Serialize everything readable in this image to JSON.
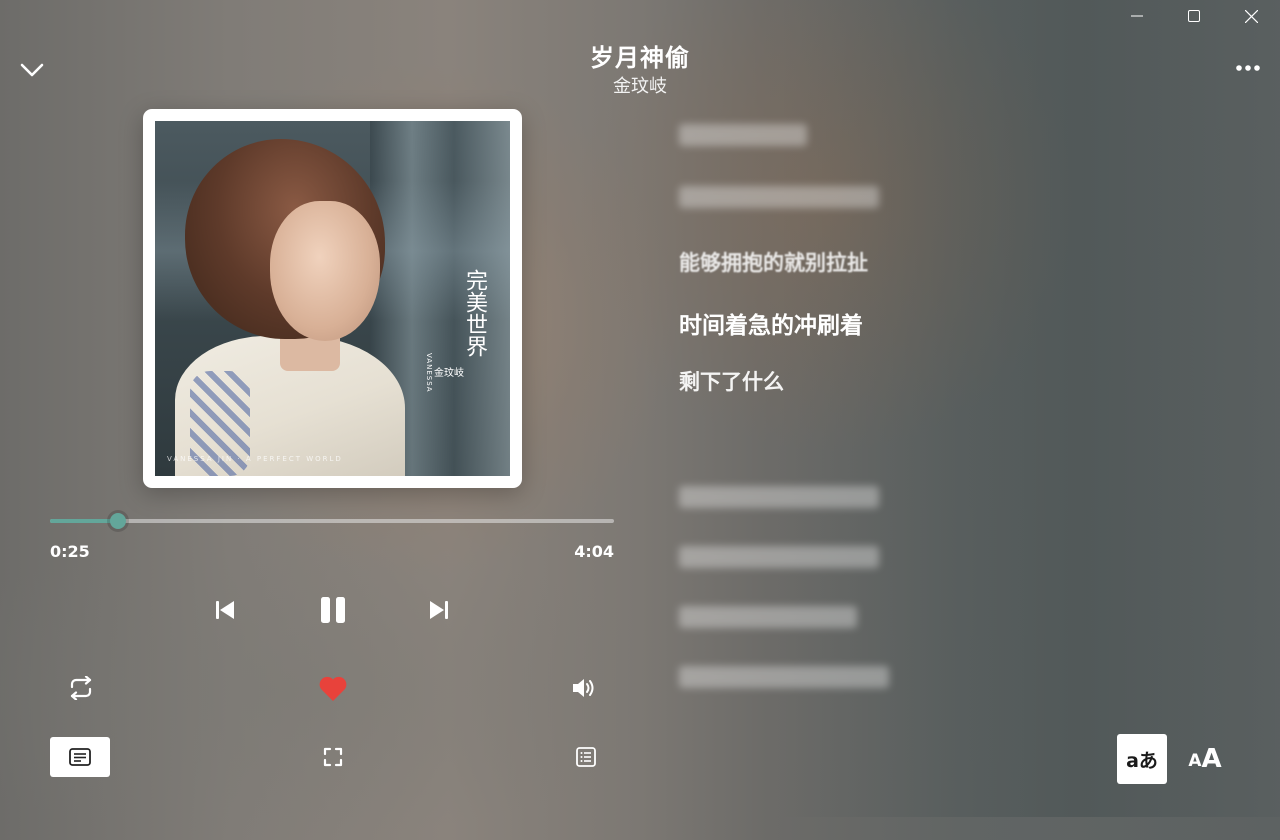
{
  "window": {
    "minimize_icon": "minimize-icon",
    "maximize_icon": "maximize-icon",
    "close_icon": "close-icon"
  },
  "header": {
    "collapse_icon": "chevron-down-icon",
    "title": "岁月神偷",
    "artist": "金玟岐",
    "more_icon": "more-horizontal-icon"
  },
  "cover": {
    "album_title": "完美世界",
    "artist_en": "VANESSA",
    "artist_cn": "金玟岐",
    "bottom_text": "VANESSA  JIN  ·  A  PERFECT  WORLD"
  },
  "player": {
    "current_time": "0:25",
    "total_time": "4:04",
    "progress": 0.12,
    "accent_color": "#63a69a",
    "like_color": "#e8423b",
    "liked": true
  },
  "controls": {
    "previous_icon": "skip-previous-icon",
    "pause_icon": "pause-icon",
    "next_icon": "skip-next-icon",
    "repeat_icon": "repeat-icon",
    "like_icon": "heart-icon",
    "volume_icon": "volume-icon",
    "lyrics_icon": "lyrics-icon",
    "fullscreen_icon": "fullscreen-icon",
    "queue_icon": "playlist-icon"
  },
  "lyrics": {
    "lines": [
      "能够拥抱的就别拉扯",
      "时间着急的冲刷着",
      "剩下了什么"
    ]
  },
  "lyric_tools": {
    "translate_label": "aあ",
    "font_size_small": "A",
    "font_size_big": "A"
  }
}
